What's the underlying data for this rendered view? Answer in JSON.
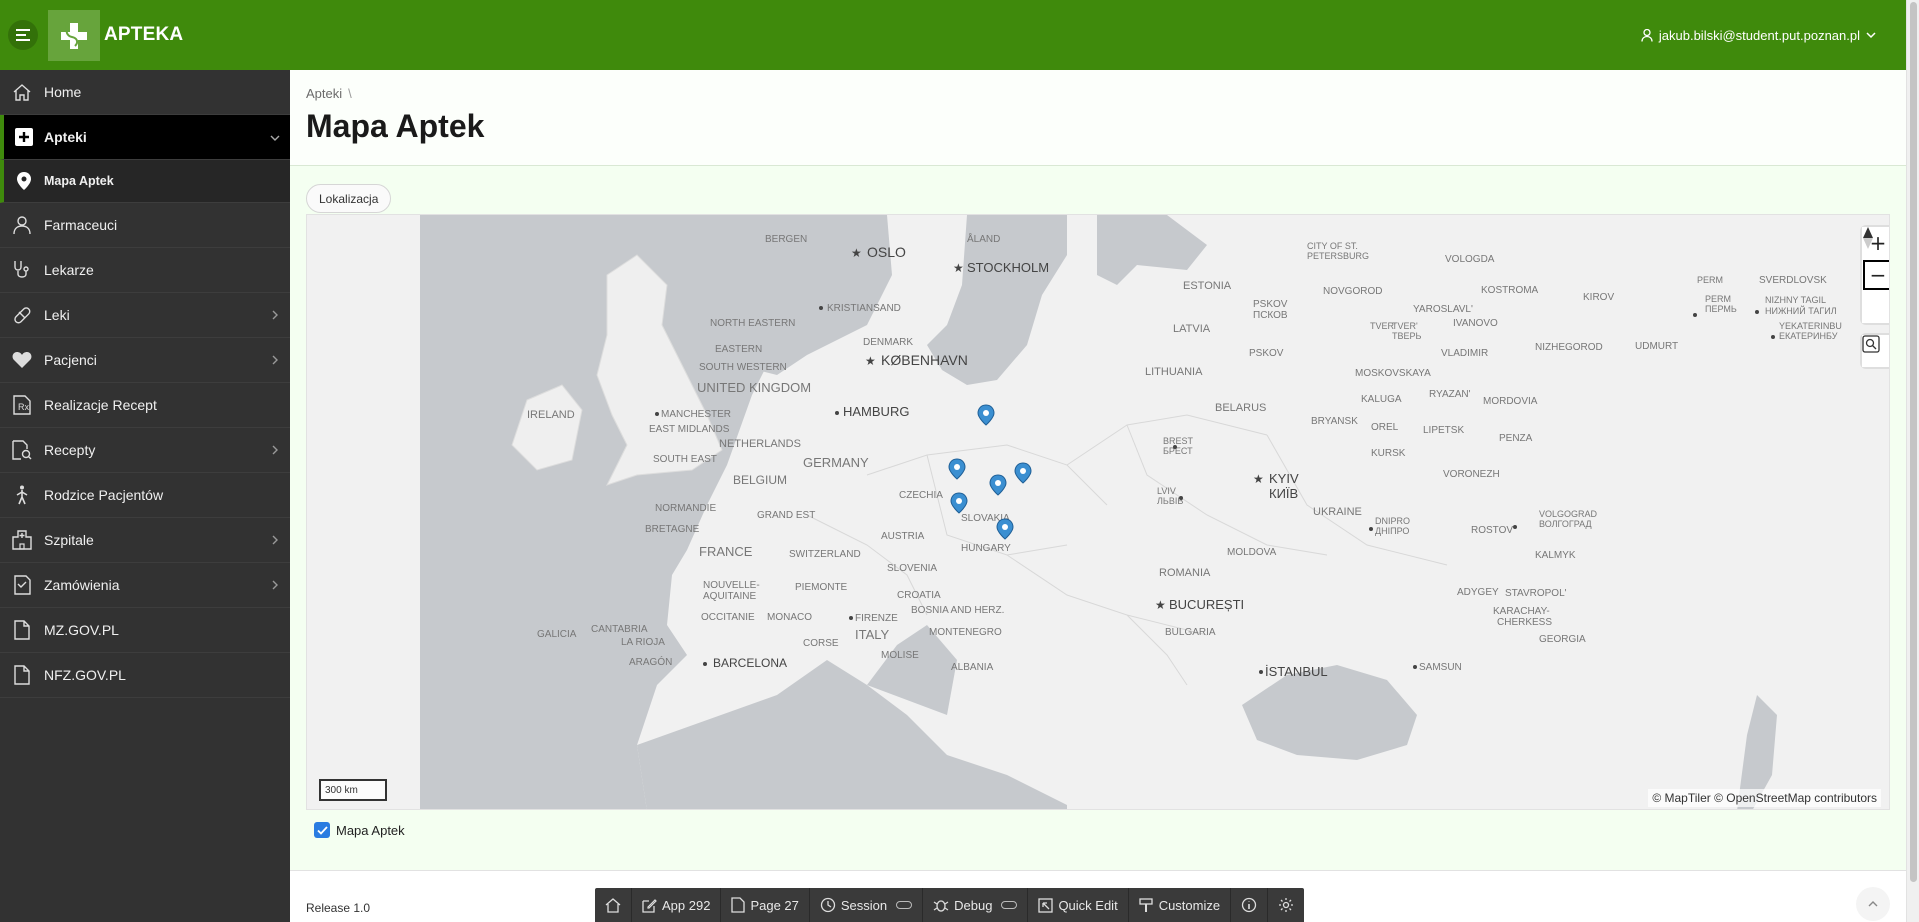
{
  "header": {
    "app_title": "APTEKA",
    "user": "jakub.bilski@student.put.poznan.pl"
  },
  "sidebar": {
    "items": [
      {
        "label": "Home",
        "icon": "home-icon"
      },
      {
        "label": "Apteki",
        "icon": "plus-square-icon",
        "expanded": true
      },
      {
        "label": "Mapa Aptek",
        "icon": "map-pin-icon",
        "current": true
      },
      {
        "label": "Farmaceuci",
        "icon": "user-icon"
      },
      {
        "label": "Lekarze",
        "icon": "stethoscope-icon"
      },
      {
        "label": "Leki",
        "icon": "pill-icon",
        "has_children": true
      },
      {
        "label": "Pacjenci",
        "icon": "heart-icon",
        "has_children": true
      },
      {
        "label": "Realizacje Recept",
        "icon": "prescription-icon"
      },
      {
        "label": "Recepty",
        "icon": "document-search-icon",
        "has_children": true
      },
      {
        "label": "Rodzice Pacjentów",
        "icon": "person-walking-icon"
      },
      {
        "label": "Szpitale",
        "icon": "hospital-icon",
        "has_children": true
      },
      {
        "label": "Zamówienia",
        "icon": "cart-icon",
        "has_children": true
      },
      {
        "label": "MZ.GOV.PL",
        "icon": "file-icon"
      },
      {
        "label": "NFZ.GOV.PL",
        "icon": "file-icon"
      }
    ]
  },
  "page": {
    "breadcrumb": "Apteki",
    "breadcrumb_sep": "\\",
    "title": "Mapa Aptek"
  },
  "region": {
    "tab_label": "Lokalizacja"
  },
  "map": {
    "scale_label": "300 km",
    "attribution": "© MapTiler  © OpenStreetMap contributors",
    "labels": {
      "bergen": "BERGEN",
      "oslo": "OSLO",
      "stockholm": "STOCKHOLM",
      "aland": "ÅLAND",
      "st_petersburg_1": "CITY OF ST.",
      "st_petersburg_2": "PETERSBURG",
      "vologda": "VOLOGDA",
      "sverdlovsk": "SVERDLOVSK",
      "kristiansand": "KRISTIANSAND",
      "estonia": "ESTONIA",
      "novgorod": "NOVGOROD",
      "kostroma": "KOSTROMA",
      "kirov": "KIROV",
      "perm_1": "PERM",
      "perm_2": "PERM",
      "perm_3": "ПЕРМЬ",
      "nizhny_1": "NIZHNY TAGIL",
      "nizhny_2": "НИЖНИЙ ТАГИЛ",
      "yekat_1": "YEKATERINBU",
      "yekat_2": "ЕКАТЕРИНБУ",
      "north_eastern": "NORTH EASTERN",
      "pskov_1": "PSKOV",
      "pskov_2": "ПСКОВ",
      "yaroslavl": "YAROSLAVL'",
      "ivanovo": "IVANOVO",
      "tver_1": "TVER'",
      "tver_2": "TVER'",
      "tver_3": "ТВЕРЬ",
      "latvia": "LATVIA",
      "denmark": "DENMARK",
      "eastern": "EASTERN",
      "south_western": "SOUTH WESTERN",
      "kobenhavn": "KØBENHAVN",
      "pskov_3": "PSKOV",
      "vladimir": "VLADIMIR",
      "nizhegorod": "NIZHEGOROD",
      "udmurt": "UDMURT",
      "uk": "UNITED KINGDOM",
      "lithuania": "LITHUANIA",
      "moskovskaya": "MOSKOVSKAYA",
      "ireland": "IRELAND",
      "manchester": "MANCHESTER",
      "hamburg": "HAMBURG",
      "belarus": "BELARUS",
      "kaluga": "KALUGA",
      "ryazan": "RYAZAN'",
      "mordovia": "MORDOVIA",
      "east_midlands": "EAST MIDLANDS",
      "netherlands": "NETHERLANDS",
      "bryansk": "BRYANSK",
      "orel": "OREL",
      "lipetsk": "LIPETSK",
      "penza": "PENZA",
      "brest_1": "BREST",
      "brest_2": "БРЕСТ",
      "south_east": "SOUTH EAST",
      "germany": "GERMANY",
      "kursk": "KURSK",
      "belgium": "BELGIUM",
      "kyiv_1": "KYIV",
      "kyiv_2": "КИЇВ",
      "voronezh": "VORONEZH",
      "czechia": "CZECHIA",
      "lviv_1": "LVIV",
      "lviv_2": "ЛЬВІВ",
      "normandie": "NORMANDIE",
      "ukraine": "UKRAINE",
      "volgograd_1": "VOLGOGRAD",
      "volgograd_2": "ВОЛГОГРАД",
      "grand_est": "GRAND EST",
      "slovakia": "SLOVAKIA",
      "dnipro_1": "DNIPRO",
      "dnipro_2": "ДНІПРО",
      "rostov": "ROSTOV",
      "bretagne": "BRETAGNE",
      "austria": "AUSTRIA",
      "france": "FRANCE",
      "switzerland": "SWITZERLAND",
      "hungary": "HUNGARY",
      "moldova": "MOLDOVA",
      "kalmyk": "KALMYK",
      "slovenia": "SLOVENIA",
      "romania": "ROMANIA",
      "nouvelle_1": "NOUVELLE-",
      "nouvelle_2": "AQUITAINE",
      "piemonte": "PIEMONTE",
      "croatia": "CROATIA",
      "adygey": "ADYGEY",
      "stavropol": "STAVROPOL'",
      "bosnia": "BOSNIA AND HERZ.",
      "bucuresti": "BUCUREȘTI",
      "occitanie": "OCCITANIE",
      "monaco": "MONACO",
      "firenze": "FIRENZE",
      "karachay_1": "KARACHAY-",
      "karachay_2": "CHERKESS",
      "galicia": "GALICIA",
      "cantabria": "CANTABRIA",
      "la_rioja": "LA RIOJA",
      "corse": "CORSE",
      "italy": "ITALY",
      "montenegro": "MONTENEGRO",
      "bulgaria": "BULGARIA",
      "georgia": "GEORGIA",
      "aragon": "ARAGÓN",
      "molise": "MOLISE",
      "barcelona": "BARCELONA",
      "albania": "ALBANIA",
      "istanbul": "İSTANBUL",
      "samsun": "SAMSUN"
    }
  },
  "legend": {
    "label": "Mapa Aptek",
    "checked": true
  },
  "footer": {
    "release": "Release 1.0"
  },
  "dev_toolbar": {
    "app": "App 292",
    "page": "Page 27",
    "session": "Session",
    "debug": "Debug",
    "quick_edit": "Quick Edit",
    "customize": "Customize"
  },
  "colors": {
    "header": "#3f8a0c",
    "sidebar": "#323232",
    "content_bg": "#f4fff1",
    "marker": "#3b8fd1",
    "sea": "#c9ccd0",
    "land": "#f2f2f2"
  }
}
